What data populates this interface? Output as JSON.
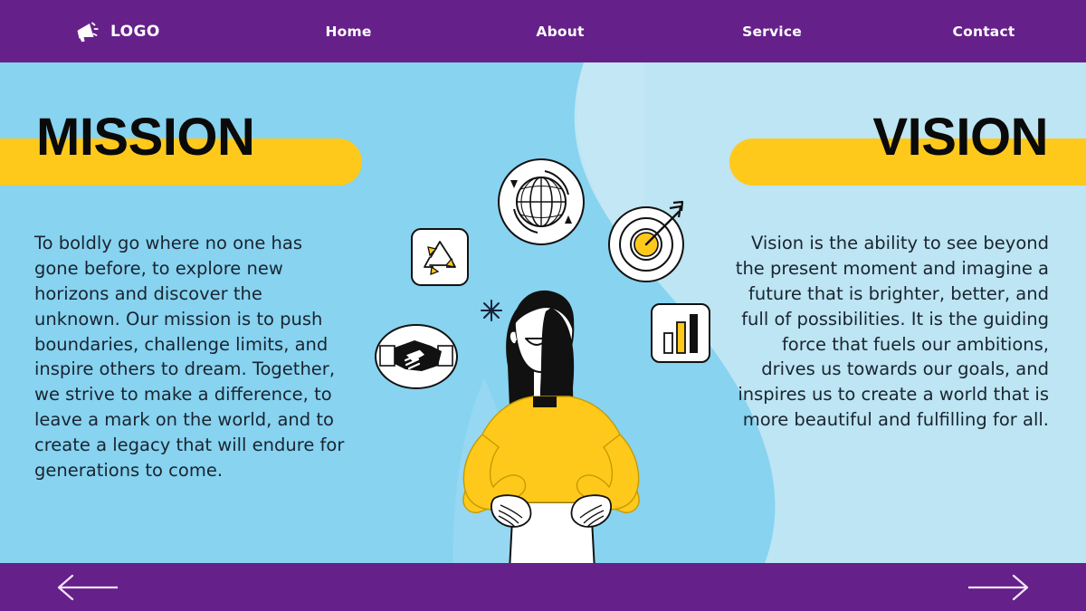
{
  "header": {
    "brand": {
      "logo_icon": "megaphone-icon",
      "label": "LOGO"
    },
    "nav": [
      {
        "label": "Home"
      },
      {
        "label": "About"
      },
      {
        "label": "Service"
      },
      {
        "label": "Contact"
      }
    ]
  },
  "mission": {
    "heading": "MISSION",
    "body": "To boldly go where no one has gone before, to explore new horizons and discover the unknown. Our mission is to push boundaries, challenge limits, and inspire others to dream. Together, we strive to make a difference, to leave a mark on the world, and to create a legacy that will endure for generations to come."
  },
  "vision": {
    "heading": "VISION",
    "body": "Vision is the ability to see beyond the present moment and imagine a future that is brighter, better, and full of possibilities. It is the guiding force that fuels our ambitions, drives us towards our goals, and inspires us to create a world that is more beautiful and fulfilling for all."
  },
  "illustration": {
    "icons": [
      {
        "name": "globe-icon",
        "description": "globe with rotating arrows"
      },
      {
        "name": "recycle-icon",
        "description": "recycling triangle arrows in rounded square"
      },
      {
        "name": "target-icon",
        "description": "target with arrow in bullseye"
      },
      {
        "name": "handshake-icon",
        "description": "handshake inside oval"
      },
      {
        "name": "bar-chart-icon",
        "description": "three bar chart in rounded square"
      },
      {
        "name": "sparkle-icon",
        "description": "small asterisk sparkle"
      }
    ],
    "character": {
      "name": "woman-character",
      "description": "woman with long black hair, yellow sweater, hands on hips, white skirt"
    }
  },
  "footer": {
    "prev_label": "previous-slide",
    "next_label": "next-slide"
  },
  "colors": {
    "purple": "#66208A",
    "sky_blue": "#87D3F0",
    "light_blue": "#BDE5F3",
    "yellow": "#FFC91C",
    "black": "#111111",
    "white": "#FFFFFF"
  }
}
